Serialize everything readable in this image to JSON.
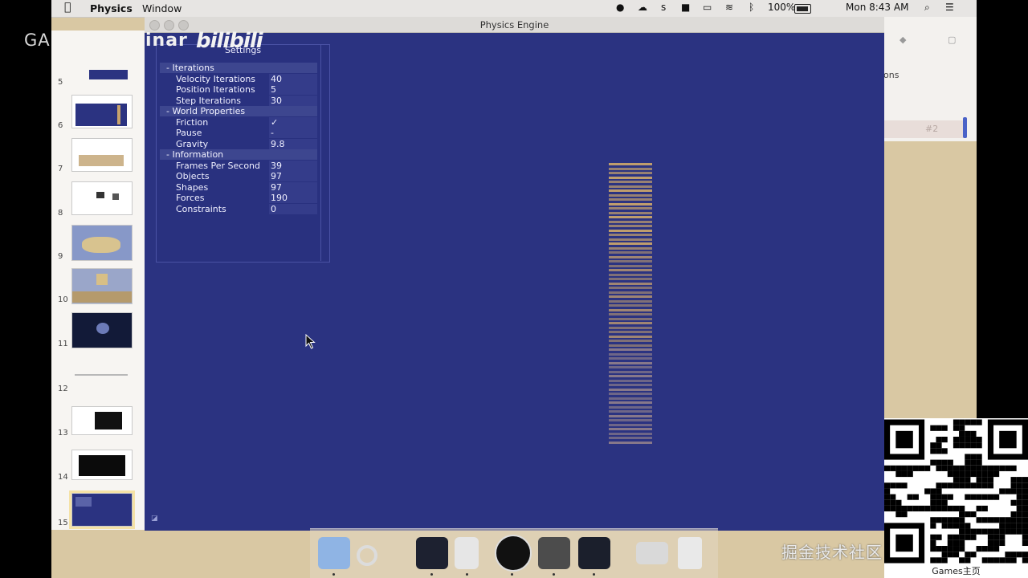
{
  "menubar": {
    "app_name": "Physics",
    "menu_window": "Window",
    "battery": "100%",
    "clock": "Mon 8:43 AM",
    "tray_s": "s"
  },
  "window": {
    "title": "Physics Engine"
  },
  "settings": {
    "title": "Settings",
    "groups": [
      {
        "label": "- Iterations",
        "rows": [
          {
            "label": "Velocity Iterations",
            "value": "40"
          },
          {
            "label": "Position Iterations",
            "value": "5"
          },
          {
            "label": "Step Iterations",
            "value": "30"
          }
        ]
      },
      {
        "label": "- World Properties",
        "rows": [
          {
            "label": "Friction",
            "value": "✓"
          },
          {
            "label": "Pause",
            "value": "-"
          },
          {
            "label": "Gravity",
            "value": "9.8"
          }
        ]
      },
      {
        "label": "- Information",
        "rows": [
          {
            "label": "Frames Per Second",
            "value": "39"
          },
          {
            "label": "Objects",
            "value": "97"
          },
          {
            "label": "Shapes",
            "value": "97"
          },
          {
            "label": "Forces",
            "value": "190"
          },
          {
            "label": "Constraints",
            "value": "0"
          }
        ]
      }
    ]
  },
  "sidebar": {
    "thumbnails": [
      "5",
      "6",
      "7",
      "8",
      "9",
      "10",
      "11",
      "12",
      "13",
      "14",
      "15"
    ]
  },
  "background_app": {
    "label_ons": "ons",
    "label_two": "#2"
  },
  "overlay": {
    "left_text": "GA",
    "seminar_text": "inar",
    "logo": "bilibili",
    "watermark": "掘金技术社区 @ 布客飞龙",
    "qr_caption": "Games主页"
  },
  "colors": {
    "viewport_bg": "#2b3381",
    "plank": "#c7a36c",
    "qr_dark": "#000000"
  }
}
